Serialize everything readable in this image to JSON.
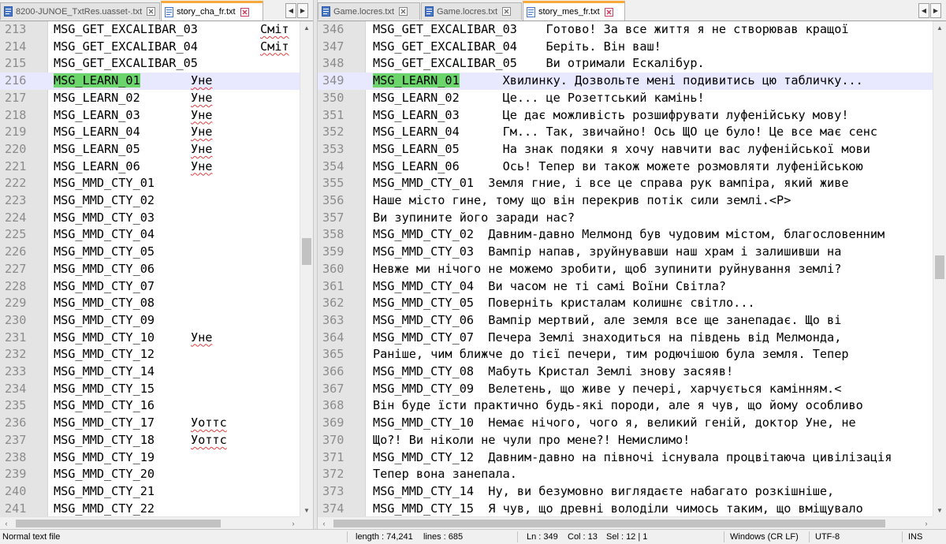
{
  "left_pane": {
    "tabs": [
      {
        "label": "8200-JUNOE_TxtRes.uasset-.txt",
        "active": false
      },
      {
        "label": "story_cha_fr.txt",
        "active": true
      }
    ],
    "lines": [
      {
        "n": "213",
        "text": "MSG_GET_EXCALIBAR_03",
        "extra": "Сміт"
      },
      {
        "n": "214",
        "text": "MSG_GET_EXCALIBAR_04",
        "extra": "Сміт"
      },
      {
        "n": "215",
        "text": "MSG_GET_EXCALIBAR_05",
        "extra": ""
      },
      {
        "n": "216",
        "text": "MSG_LEARN_01",
        "extra": "Уне"
      },
      {
        "n": "217",
        "text": "MSG_LEARN_02",
        "extra": "Уне"
      },
      {
        "n": "218",
        "text": "MSG_LEARN_03",
        "extra": "Уне"
      },
      {
        "n": "219",
        "text": "MSG_LEARN_04",
        "extra": "Уне"
      },
      {
        "n": "220",
        "text": "MSG_LEARN_05",
        "extra": "Уне"
      },
      {
        "n": "221",
        "text": "MSG_LEARN_06",
        "extra": "Уне"
      },
      {
        "n": "222",
        "text": "MSG_MMD_CTY_01",
        "extra": ""
      },
      {
        "n": "223",
        "text": "MSG_MMD_CTY_02",
        "extra": ""
      },
      {
        "n": "224",
        "text": "MSG_MMD_CTY_03",
        "extra": ""
      },
      {
        "n": "225",
        "text": "MSG_MMD_CTY_04",
        "extra": ""
      },
      {
        "n": "226",
        "text": "MSG_MMD_CTY_05",
        "extra": ""
      },
      {
        "n": "227",
        "text": "MSG_MMD_CTY_06",
        "extra": ""
      },
      {
        "n": "228",
        "text": "MSG_MMD_CTY_07",
        "extra": ""
      },
      {
        "n": "229",
        "text": "MSG_MMD_CTY_08",
        "extra": ""
      },
      {
        "n": "230",
        "text": "MSG_MMD_CTY_09",
        "extra": ""
      },
      {
        "n": "231",
        "text": "MSG_MMD_CTY_10",
        "extra": "Уне"
      },
      {
        "n": "232",
        "text": "MSG_MMD_CTY_12",
        "extra": ""
      },
      {
        "n": "233",
        "text": "MSG_MMD_CTY_14",
        "extra": ""
      },
      {
        "n": "234",
        "text": "MSG_MMD_CTY_15",
        "extra": ""
      },
      {
        "n": "235",
        "text": "MSG_MMD_CTY_16",
        "extra": ""
      },
      {
        "n": "236",
        "text": "MSG_MMD_CTY_17",
        "extra": "Уоттс"
      },
      {
        "n": "237",
        "text": "MSG_MMD_CTY_18",
        "extra": "Уоттс"
      },
      {
        "n": "238",
        "text": "MSG_MMD_CTY_19",
        "extra": ""
      },
      {
        "n": "239",
        "text": "MSG_MMD_CTY_20",
        "extra": ""
      },
      {
        "n": "240",
        "text": "MSG_MMD_CTY_21",
        "extra": ""
      },
      {
        "n": "241",
        "text": "MSG_MMD_CTY_22",
        "extra": ""
      }
    ]
  },
  "right_pane": {
    "tabs": [
      {
        "label": "Game.locres.txt",
        "active": false
      },
      {
        "label": "Game.locres.txt",
        "active": false
      },
      {
        "label": "story_mes_fr.txt",
        "active": true
      }
    ],
    "lines": [
      {
        "n": "346",
        "text": "MSG_GET_EXCALIBAR_03    Готово! За все життя я не створював кращої"
      },
      {
        "n": "347",
        "text": "MSG_GET_EXCALIBAR_04    Беріть. Він ваш!"
      },
      {
        "n": "348",
        "text": "MSG_GET_EXCALIBAR_05    Ви отримали Ескалібур."
      },
      {
        "n": "349",
        "text": "MSG_LEARN_01      Хвилинку. Дозвольте мені подивитись цю табличку..."
      },
      {
        "n": "350",
        "text": "MSG_LEARN_02      Це... це Розеттський камінь!"
      },
      {
        "n": "351",
        "text": "MSG_LEARN_03      Це дає можливість розшифрувати луфенійську мову!"
      },
      {
        "n": "352",
        "text": "MSG_LEARN_04      Гм... Так, звичайно! Ось ЩО це було! Це все має сенс"
      },
      {
        "n": "353",
        "text": "MSG_LEARN_05      На знак подяки я хочу навчити вас луфенійської мови"
      },
      {
        "n": "354",
        "text": "MSG_LEARN_06      Ось! Тепер ви також можете розмовляти луфенійською"
      },
      {
        "n": "355",
        "text": "MSG_MMD_CTY_01  Земля гние, і все це справа рук вампіра, який живе"
      },
      {
        "n": "356",
        "text": "Наше місто гине, тому що він перекрив потік сили землі.<P>"
      },
      {
        "n": "357",
        "text": "Ви зупините його заради нас?"
      },
      {
        "n": "358",
        "text": "MSG_MMD_CTY_02  Давним-давно Мелмонд був чудовим містом, благословенним"
      },
      {
        "n": "359",
        "text": "MSG_MMD_CTY_03  Вампір напав, зруйнувавши наш храм і залишивши на"
      },
      {
        "n": "360",
        "text": "Невже ми нічого не можемо зробити, щоб зупинити руйнування землі?"
      },
      {
        "n": "361",
        "text": "MSG_MMD_CTY_04  Ви часом не ті самі Воїни Світла?"
      },
      {
        "n": "362",
        "text": "MSG_MMD_CTY_05  Поверніть кристалам колишнє світло..."
      },
      {
        "n": "363",
        "text": "MSG_MMD_CTY_06  Вампір мертвий, але земля все ще занепадає. Що ві"
      },
      {
        "n": "364",
        "text": "MSG_MMD_CTY_07  Печера Землі знаходиться на південь від Мелмонда,"
      },
      {
        "n": "365",
        "text": "Раніше, чим ближче до тієї печери, тим родючішою була земля. Тепер"
      },
      {
        "n": "366",
        "text": "MSG_MMD_CTY_08  Мабуть Кристал Землі знову засяяв!"
      },
      {
        "n": "367",
        "text": "MSG_MMD_CTY_09  Велетень, що живе у печері, харчується камінням.<"
      },
      {
        "n": "368",
        "text": "Він буде їсти практично будь-які породи, але я чув, що йому особливо"
      },
      {
        "n": "369",
        "text": "MSG_MMD_CTY_10  Немає нічого, чого я, великий геній, доктор Уне, не"
      },
      {
        "n": "370",
        "text": "Що?! Ви ніколи не чули про мене?! Немислимо!"
      },
      {
        "n": "371",
        "text": "MSG_MMD_CTY_12  Давним-давно на півночі існувала процвітаюча цивілізація"
      },
      {
        "n": "372",
        "text": "Тепер вона занепала."
      },
      {
        "n": "373",
        "text": "MSG_MMD_CTY_14  Ну, ви безумовно виглядаєте набагато розкішніше,"
      },
      {
        "n": "374",
        "text": "MSG_MMD_CTY_15  Я чув, що древні володіли чимось таким, що вміщувало"
      }
    ]
  },
  "status": {
    "file_type": "Normal text file",
    "length": "length : 74,241",
    "lines": "lines : 685",
    "ln": "Ln : 349",
    "col": "Col : 13",
    "sel": "Sel : 12 | 1",
    "eol": "Windows (CR LF)",
    "encoding": "UTF-8",
    "mode": "INS"
  }
}
